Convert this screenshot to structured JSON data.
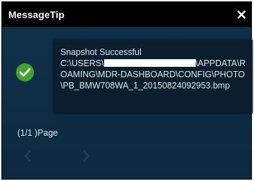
{
  "window": {
    "title": "MessageTip",
    "close_icon": "close-icon"
  },
  "message": {
    "status_icon": "check-circle-icon",
    "status_color": "#3fa52c",
    "heading": "Snapshot Successful",
    "path_start": "C:\\USERS\\",
    "path_rest": "\\APPDATA\\ROAMING\\MDR-DASHBOARD\\CONFIG\\PHOTO\\PB_BMW708WA_1_20150824092953.bmp"
  },
  "pager": {
    "page_label": "(1/1 )Page",
    "prev_icon": "chevron-left-icon",
    "next_icon": "chevron-right-icon"
  }
}
